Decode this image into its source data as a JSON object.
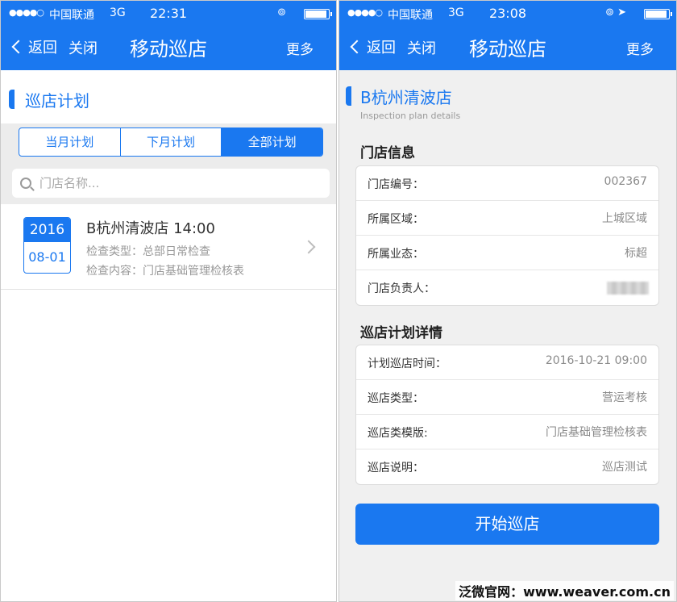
{
  "left": {
    "status": {
      "signal": "●●●●○",
      "carrier": "中国联通",
      "network": "3G",
      "time": "22:31",
      "icons": "⊚"
    },
    "nav": {
      "back": "返回",
      "close": "关闭",
      "title": "移动巡店",
      "more": "更多"
    },
    "section_title": "巡店计划",
    "tabs": [
      {
        "label": "当月计划",
        "active": false
      },
      {
        "label": "下月计划",
        "active": false
      },
      {
        "label": "全部计划",
        "active": true
      }
    ],
    "search": {
      "placeholder": "门店名称...",
      "value": ""
    },
    "plans": [
      {
        "year": "2016",
        "date": "08-01",
        "title": "B杭州清波店 14:00",
        "type_line": "检查类型：总部日常检查",
        "content_line": "检查内容：门店基础管理检核表"
      }
    ]
  },
  "right": {
    "status": {
      "signal": "●●●●○",
      "carrier": "中国联通",
      "network": "3G",
      "time": "23:08",
      "icons": "⊚ ➤"
    },
    "nav": {
      "back": "返回",
      "close": "关闭",
      "title": "移动巡店",
      "more": "更多"
    },
    "store_title": "B杭州清波店",
    "store_subtitle": "Inspection plan details",
    "store_info": {
      "title": "门店信息",
      "rows": [
        {
          "label": "门店编号：",
          "value": "002367"
        },
        {
          "label": "所属区域：",
          "value": "上城区域"
        },
        {
          "label": "所属业态：",
          "value": "标超"
        },
        {
          "label": "门店负责人：",
          "value": ""
        }
      ]
    },
    "plan_details": {
      "title": "巡店计划详情",
      "rows": [
        {
          "label": "计划巡店时间：",
          "value": "2016-10-21 09:00"
        },
        {
          "label": "巡店类型：",
          "value": "营运考核"
        },
        {
          "label": "巡店类模版:",
          "value": "门店基础管理检核表"
        },
        {
          "label": "巡店说明：",
          "value": "巡店测试"
        }
      ]
    },
    "start_button": "开始巡店"
  },
  "watermark": "泛微官网：www.weaver.com.cn",
  "colors": {
    "primary": "#1a78f0",
    "background": "#f0f0f0"
  }
}
